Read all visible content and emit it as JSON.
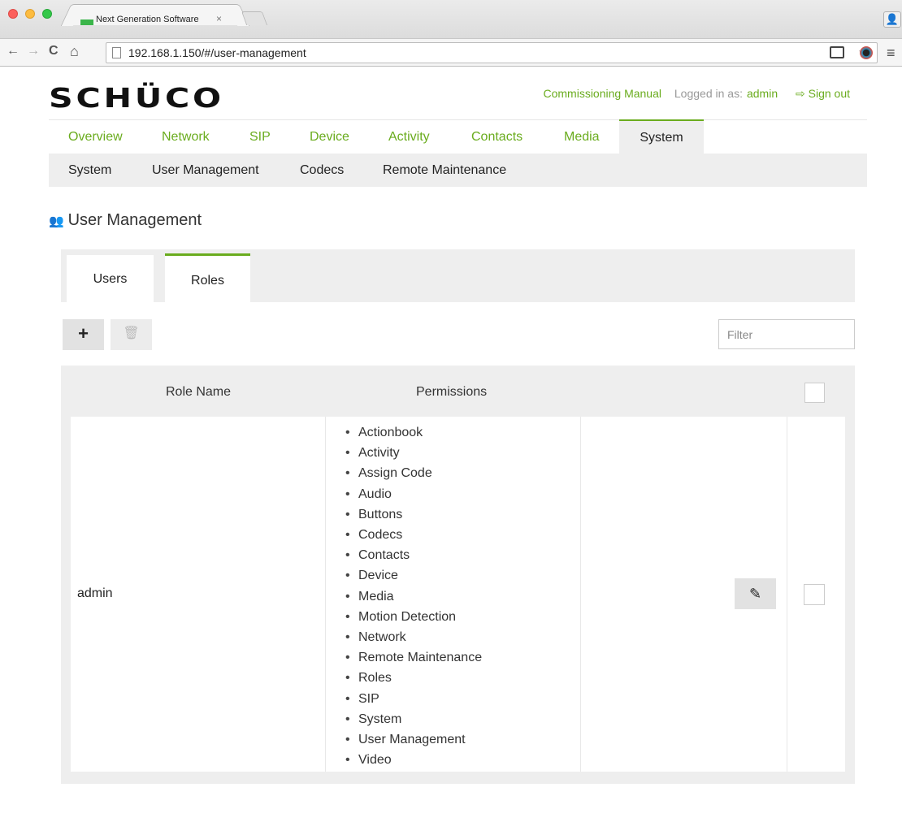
{
  "browser": {
    "tab_title": "Next Generation Software",
    "tab_close": "×",
    "url": "192.168.1.150/#/user-management",
    "back": "←",
    "forward": "→",
    "reload": "C",
    "home": "⌂",
    "star": "☆",
    "menu": "≡",
    "profile": "👤"
  },
  "header": {
    "logo": "SCHÜCO",
    "manual_link": "Commissioning Manual",
    "logged_in_label": "Logged in as:",
    "user": "admin",
    "sign_out": "Sign out",
    "sign_out_icon": "⇨"
  },
  "main_nav": [
    "Overview",
    "Network",
    "SIP",
    "Device",
    "Activity",
    "Contacts",
    "Media",
    "System"
  ],
  "sub_nav": [
    "System",
    "User Management",
    "Codecs",
    "Remote Maintenance"
  ],
  "page": {
    "title": "User Management",
    "title_icon": "👥"
  },
  "tabs": [
    "Users",
    "Roles"
  ],
  "toolbar": {
    "add": "+",
    "delete": "🗑",
    "filter_placeholder": "Filter"
  },
  "table": {
    "columns": [
      "Role Name",
      "Permissions"
    ],
    "rows": [
      {
        "role": "admin",
        "permissions": [
          "Actionbook",
          "Activity",
          "Assign Code",
          "Audio",
          "Buttons",
          "Codecs",
          "Contacts",
          "Device",
          "Media",
          "Motion Detection",
          "Network",
          "Remote Maintenance",
          "Roles",
          "SIP",
          "System",
          "User Management",
          "Video"
        ],
        "edit_icon": "✎"
      }
    ]
  },
  "colors": {
    "accent": "#6aac1e",
    "panel": "#eeeeee"
  }
}
